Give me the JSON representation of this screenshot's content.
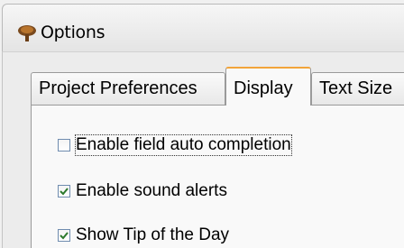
{
  "window": {
    "title": "Options",
    "icon": "tree-icon"
  },
  "tabs": [
    {
      "label": "Project Preferences",
      "selected": false
    },
    {
      "label": "Display",
      "selected": true
    },
    {
      "label": "Text Size",
      "selected": false
    }
  ],
  "options": [
    {
      "label": "Enable field auto completion",
      "checked": false,
      "focused": true
    },
    {
      "label": "Enable sound alerts",
      "checked": true,
      "focused": false
    },
    {
      "label": "Show Tip of the Day",
      "checked": true,
      "focused": false
    }
  ],
  "colors": {
    "active_tab_accent": "#f2a43a",
    "checkmark": "#2d7a2d",
    "checkbox_border": "#6f8caf"
  }
}
